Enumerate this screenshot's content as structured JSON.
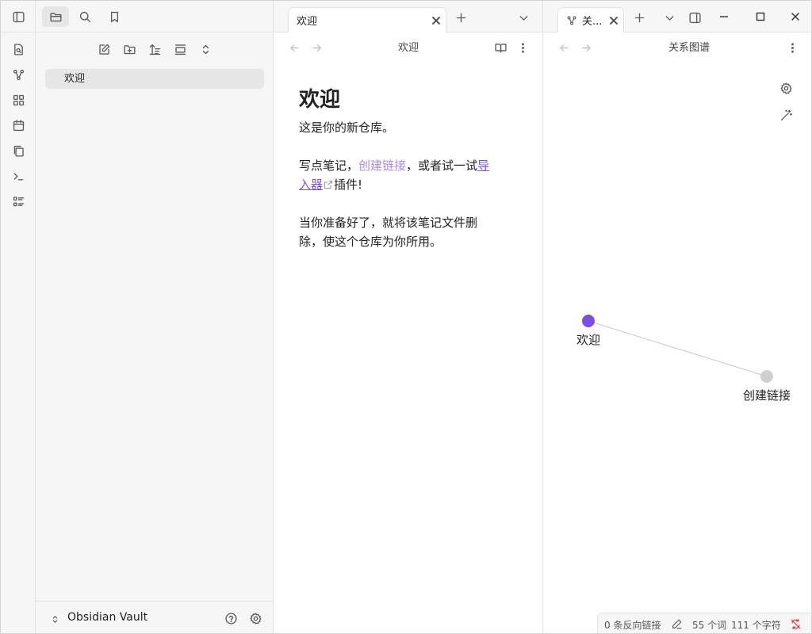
{
  "ribbon": {
    "icons": [
      "sidebar-toggle-icon",
      "quick-switcher-icon",
      "graph-view-icon",
      "canvas-icon",
      "daily-note-icon",
      "templates-icon",
      "command-palette-icon",
      "bases-icon"
    ]
  },
  "file_explorer": {
    "top_icons": [
      "files-icon",
      "search-icon",
      "bookmarks-icon"
    ],
    "toolbar": [
      "new-note-icon",
      "new-folder-icon",
      "sort-icon",
      "collapse-icon",
      "expand-icon"
    ],
    "items": [
      {
        "label": "欢迎"
      }
    ],
    "vault_name": "Obsidian Vault"
  },
  "editor": {
    "tab_label": "欢迎",
    "header_title": "欢迎",
    "heading": "欢迎",
    "para1": "这是你的新仓库。",
    "para2_before": "写点笔记，",
    "para2_link": "创建链接",
    "para2_middle": "，或者试一试",
    "para2_ext_link": "导入器",
    "para2_after": "插件!",
    "para3": "当你准备好了，就将该笔记文件删除，使这个仓库为你所用。"
  },
  "graph": {
    "tab_label": "关...",
    "header_title": "关系图谱",
    "nodes": [
      {
        "label": "欢迎",
        "color": "#7b4fe0"
      },
      {
        "label": "创建链接",
        "color": "#d0d0d0"
      }
    ]
  },
  "status": {
    "backlinks": "0 条反向链接",
    "words": "55 个词",
    "chars": "111 个字符"
  },
  "colors": {
    "accent": "#7b4fe0",
    "link": "#a88be6"
  }
}
